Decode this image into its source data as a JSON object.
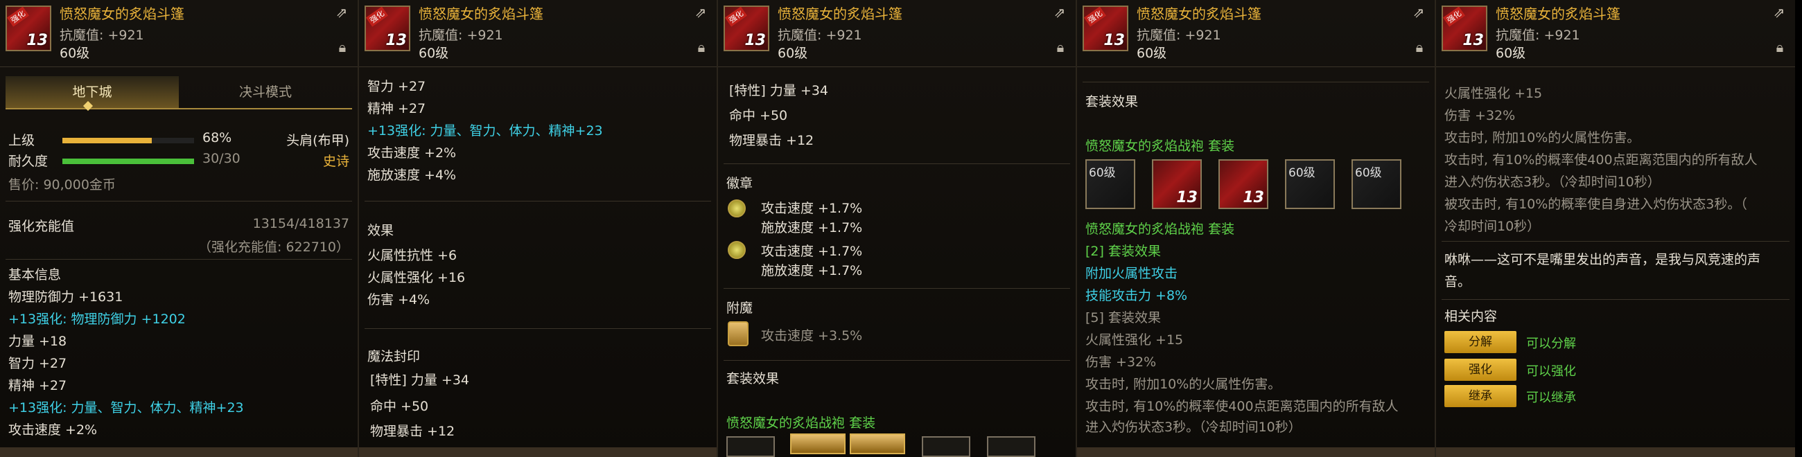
{
  "item": {
    "name": "愤怒魔女的炙焰斗篷",
    "resist": "抗魔值: +921",
    "level": "60级",
    "icon_level": "13",
    "icon_tag": "强化",
    "share_icon": "share-icon",
    "lock_icon": "lock-icon"
  },
  "p1": {
    "tab_dungeon": "地下城",
    "tab_duel": "决斗模式",
    "grade_label": "上级",
    "grade_pct": "68%",
    "grade_fill": 0.68,
    "durability_label": "耐久度",
    "durability_val": "30/30",
    "durability_fill": 1.0,
    "slot": "头肩(布甲)",
    "rarity": "史诗",
    "price": "售价: 90,000金币",
    "charge_label": "强化充能值",
    "charge_val": "13154/418137",
    "charge_sub": "（强化充能值: 622710）",
    "basic_info": "基本信息",
    "phys_def": "物理防御力 +1631",
    "enh_phys_def": "+13强化: 物理防御力 +1202",
    "str": "力量 +18",
    "int": "智力 +27",
    "spirit": "精神 +27",
    "enh_stats": "+13强化: 力量、智力、体力、精神+23",
    "atk_speed": "攻击速度 +2%"
  },
  "p2": {
    "int": "智力 +27",
    "spirit": "精神 +27",
    "enh_stats": "+13强化: 力量、智力、体力、精神+23",
    "atk_speed": "攻击速度 +2%",
    "cast_speed": "施放速度 +4%",
    "effect": "效果",
    "fire_res": "火属性抗性 +6",
    "fire_enh": "火属性强化 +16",
    "damage": "伤害 +4%",
    "magic_seal": "魔法封印",
    "seal1": "[特性] 力量 +34",
    "seal2": "命中 +50",
    "seal3": "物理暴击 +12"
  },
  "p3": {
    "seal1": "[特性] 力量 +34",
    "seal2": "命中 +50",
    "seal3": "物理暴击 +12",
    "emblem": "徽章",
    "emb1a": "攻击速度 +1.7%",
    "emb1b": "施放速度 +1.7%",
    "emb2a": "攻击速度 +1.7%",
    "emb2b": "施放速度 +1.7%",
    "enchant": "附魔",
    "enchant_val": "攻击速度 +3.5%",
    "set_effect": "套装效果",
    "set_name": "愤怒魔女的炙焰战袍",
    "set_word": "套装"
  },
  "p4": {
    "set_effect": "套装效果",
    "set_name": "愤怒魔女的炙焰战袍",
    "set_word": "套装",
    "slot_label": "60级",
    "set_name2": "愤怒魔女的炙焰战袍",
    "set_word2": "套装",
    "two_set": "[2] 套装效果",
    "add_fire": "附加火属性攻击",
    "skill_atk": "技能攻击力 +8%",
    "five_set": "[5] 套装效果",
    "fire_enh": "火属性强化 +15",
    "damage": "伤害 +32%",
    "l1": "攻击时, 附加10%的火属性伤害。",
    "l2": "攻击时, 有10%的概率使400点距离范围内的所有敌人",
    "l3": "进入灼伤状态3秒。（冷却时间10秒）"
  },
  "p5": {
    "fire_enh": "火属性强化 +15",
    "damage": "伤害 +32%",
    "l1": "攻击时, 附加10%的火属性伤害。",
    "l2": "攻击时, 有10%的概率使400点距离范围内的所有敌人",
    "l3": "进入灼伤状态3秒。（冷却时间10秒）",
    "l4": "被攻击时, 有10%的概率使自身进入灼伤状态3秒。（",
    "l5": "冷却时间10秒）",
    "flavor1": "咻咻——这可不是嘴里发出的声音，是我与风竞速的声",
    "flavor2": "音。",
    "related": "相关内容",
    "btn1": "分解",
    "btn1_desc": "可以分解",
    "btn2": "强化",
    "btn2_desc": "可以强化",
    "btn3": "继承",
    "btn3_desc": "可以继承"
  }
}
